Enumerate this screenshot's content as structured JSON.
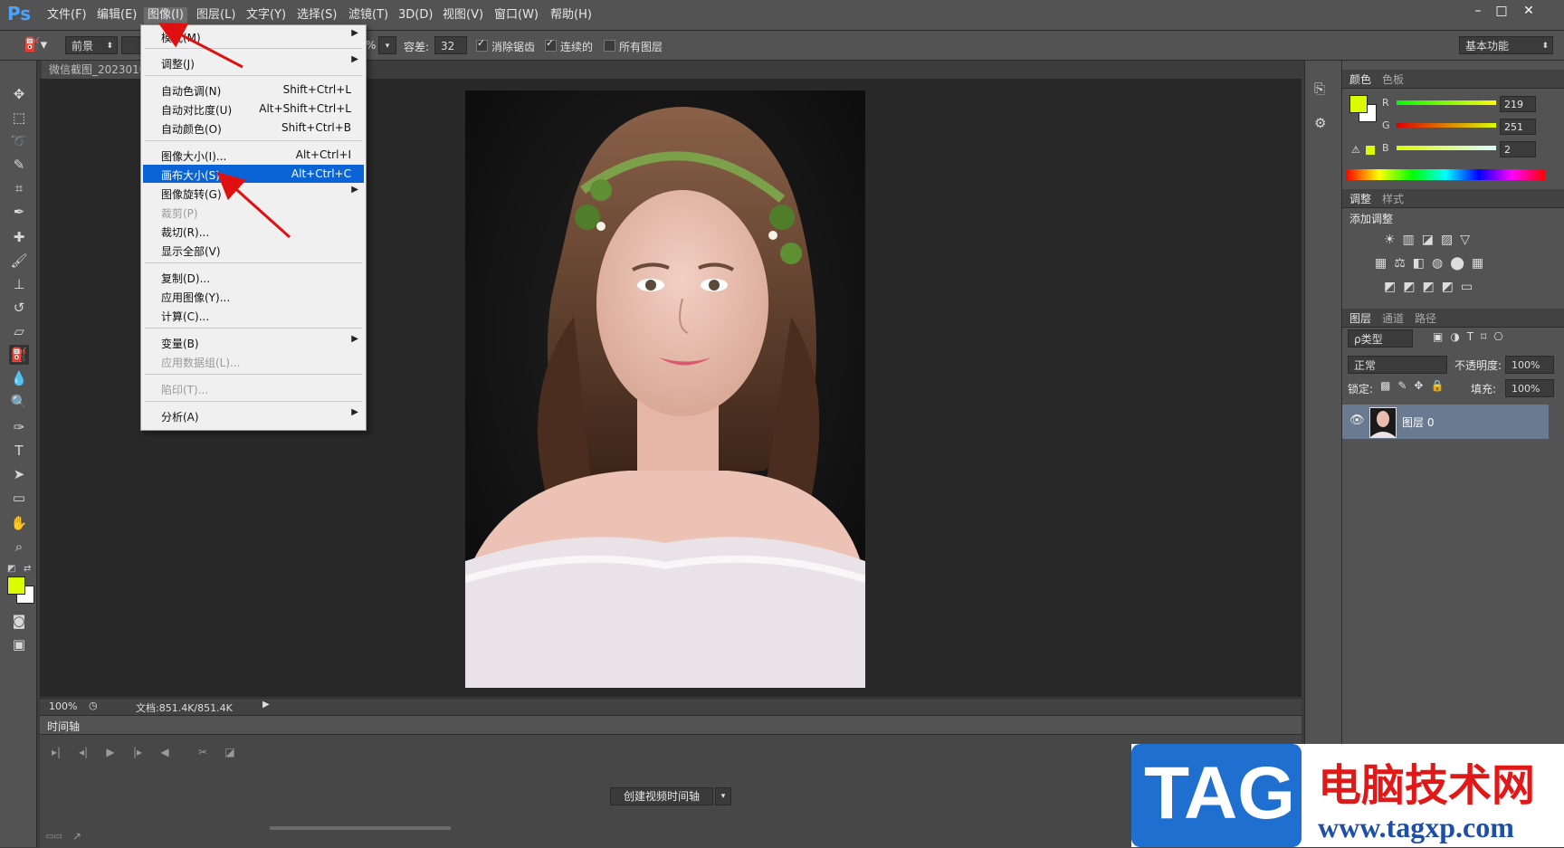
{
  "app": {
    "logo": "Ps"
  },
  "menubar": {
    "items": [
      "文件(F)",
      "编辑(E)",
      "图像(I)",
      "图层(L)",
      "文字(Y)",
      "选择(S)",
      "滤镜(T)",
      "3D(D)",
      "视图(V)",
      "窗口(W)",
      "帮助(H)"
    ],
    "window_controls": [
      "–",
      "□",
      "✕"
    ]
  },
  "options": {
    "source_value": "前景",
    "percent_fragment": "%",
    "tolerance_label": "容差:",
    "tolerance_value": "32",
    "anti_alias_label": "消除锯齿",
    "contiguous_label": "连续的",
    "all_layers_label": "所有图层",
    "workspace_value": "基本功能"
  },
  "document": {
    "tab_title": "微信截图_2023010",
    "zoom": "100%",
    "doc_info": "文档:851.4K/851.4K"
  },
  "timeline": {
    "title": "时间轴",
    "create_button": "创建视频时间轴"
  },
  "image_menu": {
    "items": [
      {
        "label": "模式(M)",
        "shortcut": "",
        "submenu": true,
        "disabled": false
      },
      {
        "label": "调整(J)",
        "shortcut": "",
        "submenu": true,
        "disabled": false
      },
      {
        "label": "自动色调(N)",
        "shortcut": "Shift+Ctrl+L",
        "submenu": false,
        "disabled": false
      },
      {
        "label": "自动对比度(U)",
        "shortcut": "Alt+Shift+Ctrl+L",
        "submenu": false,
        "disabled": false
      },
      {
        "label": "自动颜色(O)",
        "shortcut": "Shift+Ctrl+B",
        "submenu": false,
        "disabled": false
      },
      {
        "label": "图像大小(I)...",
        "shortcut": "Alt+Ctrl+I",
        "submenu": false,
        "disabled": false
      },
      {
        "label": "画布大小(S)...",
        "shortcut": "Alt+Ctrl+C",
        "submenu": false,
        "disabled": false,
        "selected": true
      },
      {
        "label": "图像旋转(G)",
        "shortcut": "",
        "submenu": true,
        "disabled": false
      },
      {
        "label": "裁剪(P)",
        "shortcut": "",
        "submenu": false,
        "disabled": true
      },
      {
        "label": "裁切(R)...",
        "shortcut": "",
        "submenu": false,
        "disabled": false
      },
      {
        "label": "显示全部(V)",
        "shortcut": "",
        "submenu": false,
        "disabled": false
      },
      {
        "label": "复制(D)...",
        "shortcut": "",
        "submenu": false,
        "disabled": false
      },
      {
        "label": "应用图像(Y)...",
        "shortcut": "",
        "submenu": false,
        "disabled": false
      },
      {
        "label": "计算(C)...",
        "shortcut": "",
        "submenu": false,
        "disabled": false
      },
      {
        "label": "变量(B)",
        "shortcut": "",
        "submenu": true,
        "disabled": false
      },
      {
        "label": "应用数据组(L)...",
        "shortcut": "",
        "submenu": false,
        "disabled": true
      },
      {
        "label": "陷印(T)...",
        "shortcut": "",
        "submenu": false,
        "disabled": true
      },
      {
        "label": "分析(A)",
        "shortcut": "",
        "submenu": true,
        "disabled": false
      }
    ]
  },
  "color_panel": {
    "tabs": [
      "颜色",
      "色板"
    ],
    "r_label": "R",
    "g_label": "G",
    "b_label": "B",
    "r": "219",
    "g": "251",
    "b": "2",
    "foreground_color": "#dbfb02"
  },
  "adjust_panel": {
    "tabs": [
      "调整",
      "样式"
    ],
    "title": "添加调整"
  },
  "layers_panel": {
    "tabs": [
      "图层",
      "通道",
      "路径"
    ],
    "filter_value": "ρ类型",
    "blend_mode": "正常",
    "opacity_label": "不透明度:",
    "opacity_value": "100%",
    "lock_label": "锁定:",
    "fill_label": "填充:",
    "fill_value": "100%",
    "layer_name": "图层 0"
  },
  "watermark": {
    "logo_text": "TAG",
    "site_name": "电脑技术网",
    "url": "www.tagxp.com"
  }
}
